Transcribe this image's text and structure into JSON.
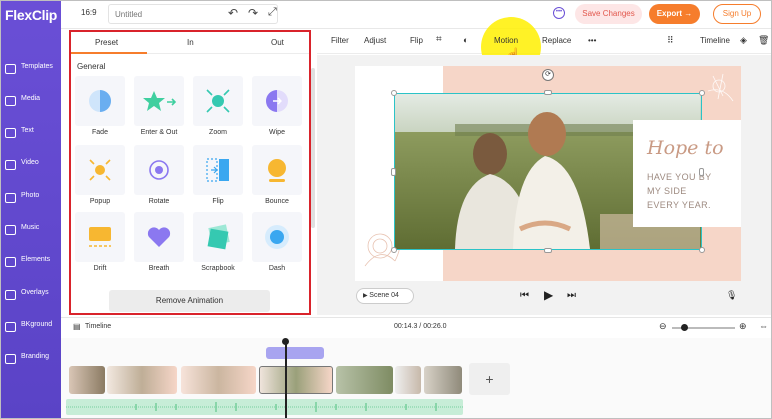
{
  "app": {
    "logo": "FlexClip"
  },
  "sidebar": {
    "items": [
      {
        "label": "Templates"
      },
      {
        "label": "Media"
      },
      {
        "label": "Text"
      },
      {
        "label": "Video"
      },
      {
        "label": "Photo"
      },
      {
        "label": "Music"
      },
      {
        "label": "Elements"
      },
      {
        "label": "Overlays"
      },
      {
        "label": "BKground"
      },
      {
        "label": "Branding"
      }
    ]
  },
  "topbar": {
    "ratio": "16:9",
    "title_placeholder": "Untitled",
    "save_label": "Save Changes",
    "export_label": "Export →",
    "signup_label": "Sign Up"
  },
  "panel": {
    "tabs": [
      "Preset",
      "In",
      "Out"
    ],
    "section": "General",
    "animations": [
      "Fade",
      "Enter & Out",
      "Zoom",
      "Wipe",
      "Popup",
      "Rotate",
      "Flip",
      "Bounce",
      "Drift",
      "Breath",
      "Scrapbook",
      "Dash"
    ],
    "remove_label": "Remove Animation"
  },
  "toolbar": {
    "filter": "Filter",
    "adjust": "Adjust",
    "flip": "Flip",
    "motion": "Motion",
    "replace": "Replace",
    "more": "•••",
    "timeline": "Timeline"
  },
  "canvas": {
    "hope": "Hope to",
    "lines": [
      "HAVE YOU BY",
      "MY SIDE",
      "EVERY YEAR."
    ]
  },
  "player": {
    "scene_label": "Scene 04"
  },
  "timeline": {
    "label": "Timeline",
    "time": "00:14.3 / 00:26.0",
    "add": "+"
  },
  "colors": {
    "brand": "#6a4fd6",
    "accent": "#f67d2c",
    "highlight": "#d9232b",
    "selection": "#2bc3c7"
  }
}
